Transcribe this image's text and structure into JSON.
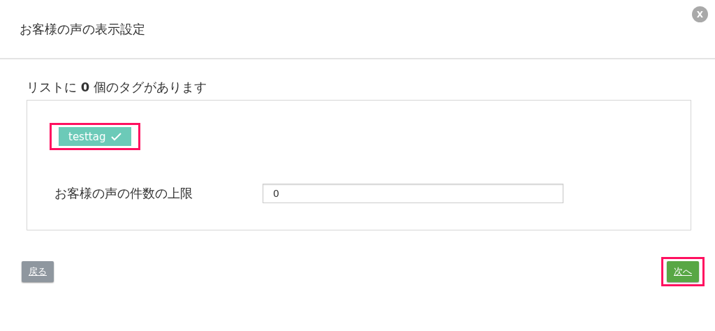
{
  "dialog": {
    "title": "お客様の声の表示設定",
    "close_label": "X"
  },
  "list_heading": "リストに **0** 個のタグがあります",
  "tags": [
    {
      "label": "testtag",
      "selected": true,
      "highlighted": true
    }
  ],
  "limit_field": {
    "label": "お客様の声の件数の上限",
    "value": "0"
  },
  "buttons": [
    {
      "kind": "back",
      "label": "戻る",
      "highlighted": false
    },
    {
      "kind": "next",
      "label": "次へ",
      "highlighted": true
    }
  ]
}
